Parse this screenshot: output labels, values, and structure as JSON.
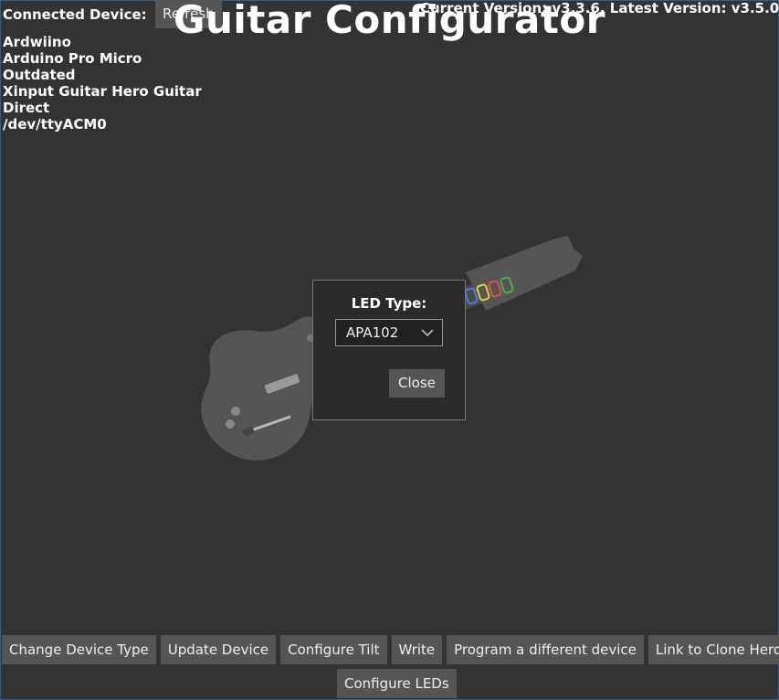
{
  "header": {
    "connected_label": "Connected Device:",
    "refresh_label": "Refresh",
    "title": "Guitar Configurator",
    "version_text": "Current Version: v3.3.6, Latest Version: v3.5.0"
  },
  "device": {
    "lines": [
      "Ardwiino",
      "Arduino Pro Micro",
      "Outdated",
      "Xinput Guitar Hero Guitar",
      "Direct",
      "/dev/ttyACM0"
    ]
  },
  "modal": {
    "title": "LED Type:",
    "selected": "APA102",
    "close_label": "Close"
  },
  "actions": {
    "change_device_type": "Change Device Type",
    "update_device": "Update Device",
    "configure_tilt": "Configure Tilt",
    "write": "Write",
    "program_different": "Program a different device",
    "link_clone_hero": "Link to Clone Hero",
    "configure_leds": "Configure LEDs"
  },
  "colors": {
    "background": "#333333",
    "button": "#555555",
    "modal": "#2a2a2a",
    "guitar_body": "#555555",
    "fret_green": "#4caf50",
    "fret_red": "#e05050",
    "fret_yellow": "#e0d040",
    "fret_blue": "#4a7fe0"
  },
  "icons": {
    "select_chevron": "chevron-down-icon"
  }
}
